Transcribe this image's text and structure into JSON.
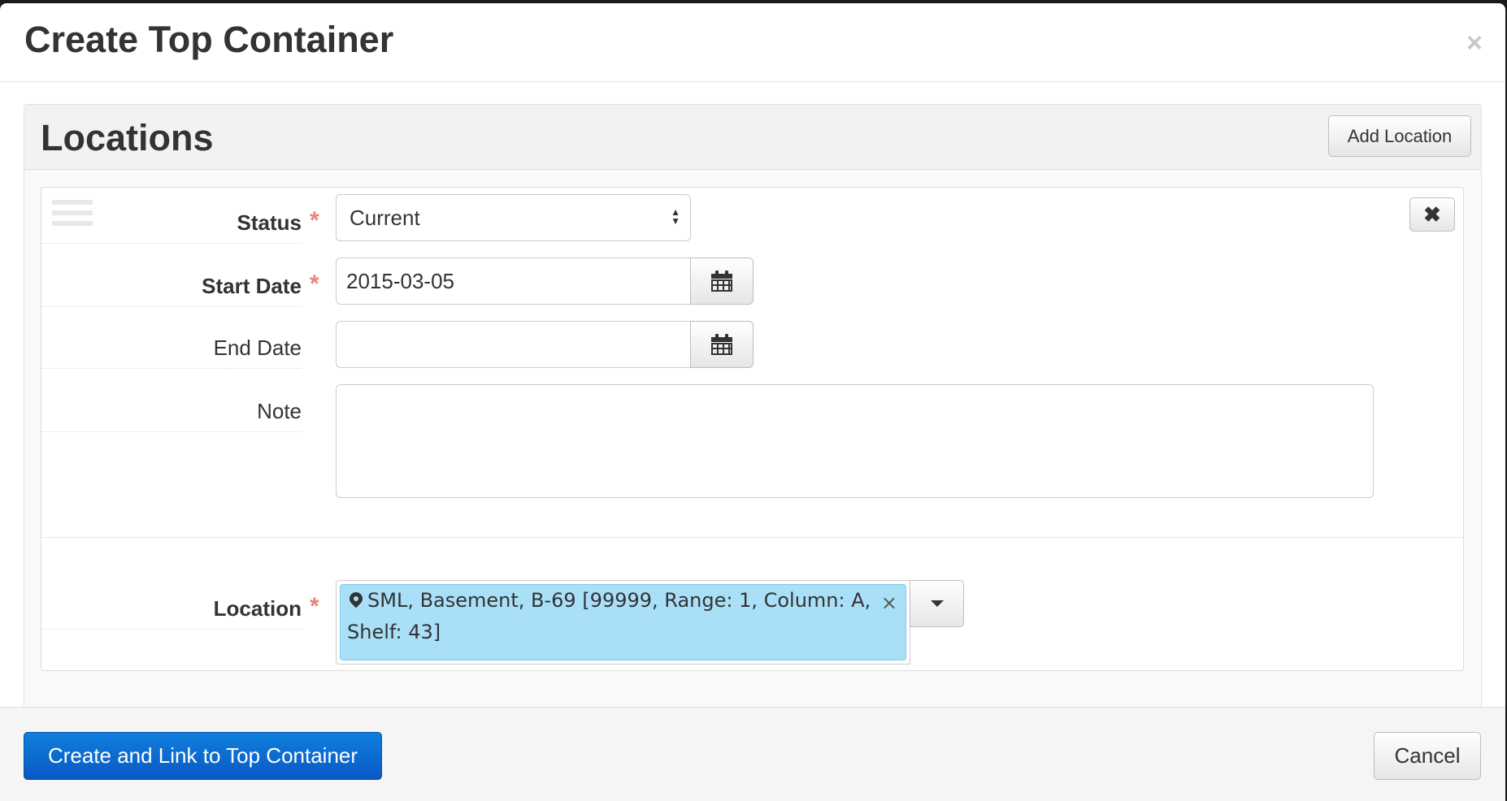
{
  "modal": {
    "title": "Create Top Container",
    "close_label": "×"
  },
  "locations_section": {
    "title": "Locations",
    "add_button_label": "Add Location",
    "remove_button_label": "✖"
  },
  "form": {
    "status": {
      "label": "Status",
      "required_mark": "*",
      "value": "Current"
    },
    "start_date": {
      "label": "Start Date",
      "required_mark": "*",
      "value": "2015-03-05"
    },
    "end_date": {
      "label": "End Date",
      "value": ""
    },
    "note": {
      "label": "Note",
      "value": ""
    },
    "location": {
      "label": "Location",
      "required_mark": "*",
      "selected_value": "SML, Basement, B-69 [99999, Range: 1, Column: A, Shelf: 43]",
      "remove_label": "×"
    }
  },
  "footer": {
    "primary_button_label": "Create and Link to Top Container",
    "cancel_button_label": "Cancel"
  },
  "icons": {
    "calendar": "calendar-icon",
    "location_pin": "map-marker-icon",
    "drag": "drag-handle-icon",
    "dropdown": "caret-down-icon"
  },
  "colors": {
    "primary_button": "#0a6fd6",
    "required_star": "#e8857a",
    "location_tag_bg": "#a9e0f8"
  }
}
